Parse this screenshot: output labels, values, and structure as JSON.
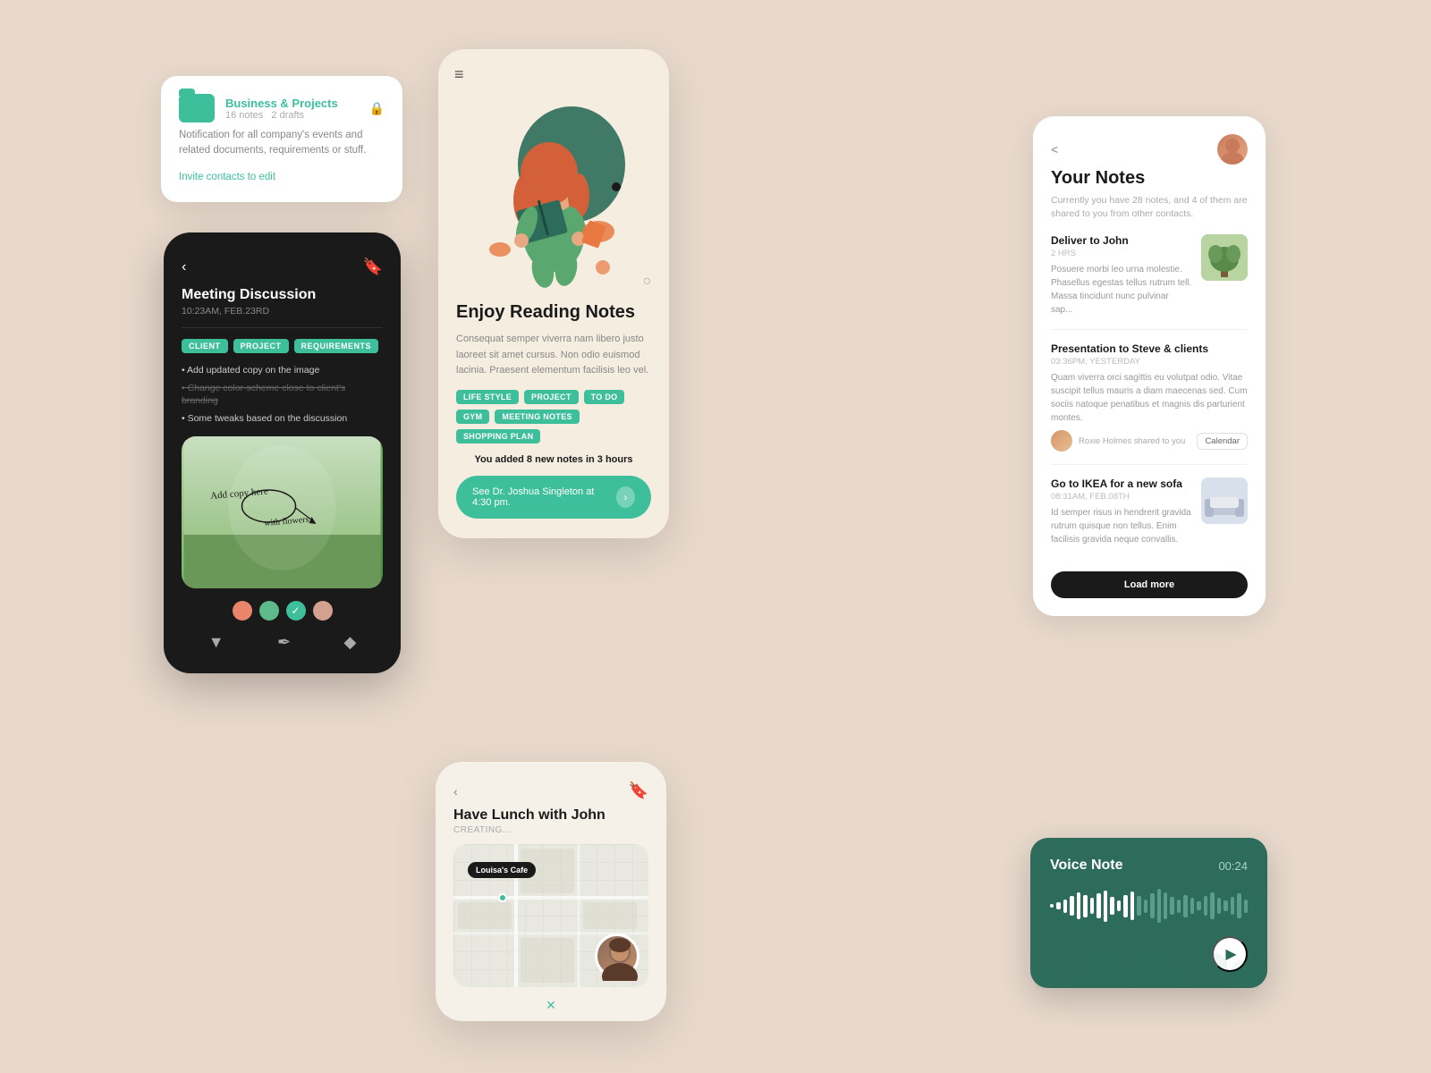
{
  "background": "#e8d9cc",
  "card_business": {
    "title": "Business & Projects",
    "notes_count": "16 notes",
    "drafts_count": "2 drafts",
    "description": "Notification for all company's events and related documents, requirements or stuff.",
    "invite_link": "Invite contacts to edit"
  },
  "card_meeting": {
    "title": "Meeting Discussion",
    "date": "10:23AM, FEB.23RD",
    "tags": [
      "CLIENT",
      "PROJECT",
      "REQUIREMENTS"
    ],
    "points": [
      {
        "text": "Add updated copy on the image",
        "strikethrough": false
      },
      {
        "text": "Change color-scheme close to client's branding",
        "strikethrough": true
      },
      {
        "text": "Some tweaks based on the discussion",
        "strikethrough": false
      }
    ],
    "img_text": "Add copy here",
    "img_subtext": "with flowers"
  },
  "card_reading": {
    "title": "Enjoy Reading Notes",
    "description": "Consequat semper viverra nam libero justo laoreet sit amet cursus. Non odio euismod lacinia. Praesent elementum facilisis leo vel.",
    "tags": [
      "LIFE STYLE",
      "PROJECT",
      "TO DO",
      "GYM",
      "MEETING NOTES",
      "SHOPPING PLAN"
    ],
    "notes_count": "You added 8 new notes in 3 hours",
    "reminder": "See Dr. Joshua Singleton at 4:30 pm."
  },
  "card_your_notes": {
    "back": "<",
    "title": "Your Notes",
    "subtitle": "Currently you have 28 notes, and 4 of them are shared to you from other contacts.",
    "notes": [
      {
        "title": "Deliver to John",
        "time": "2 HRS",
        "desc": "Posuere morbi leo urna molestie. Phasellus egestas tellus rutrum tell. Massa tincidunt nunc pulvinar sap...",
        "has_thumb": true,
        "thumb_type": "plant"
      },
      {
        "title": "Presentation to Steve & clients",
        "time": "03:36PM, YESTERDAY",
        "desc": "Quam viverra orci sagittis eu volutpat odio. Vitae suscipit tellus mauris a diam maecenas sed. Cum sociis natoque penatibus et magnis dis parturient montes.",
        "has_thumb": false,
        "shared_by": "Roxie Holmes shared to you",
        "calendar_btn": "Calendar"
      },
      {
        "title": "Go to IKEA for a new sofa",
        "time": "08:31AM, FEB.08TH",
        "desc": "Id semper risus in hendrerit gravida rutrum quisque non tellus. Enim facilisis gravida neque convallis.",
        "has_thumb": true,
        "thumb_type": "sofa"
      }
    ],
    "load_more": "Load more"
  },
  "card_lunch": {
    "title": "Have Lunch with John",
    "status": "CREATING...",
    "map_label": "Louisa's Cafe",
    "close": "×"
  },
  "card_voice": {
    "title": "Voice Note",
    "duration": "00:24",
    "wave_bars": [
      3,
      8,
      15,
      22,
      30,
      25,
      18,
      28,
      35,
      20,
      12,
      25,
      32,
      22,
      15,
      28,
      38,
      30,
      20,
      15,
      25,
      18,
      10,
      22,
      30,
      18,
      12,
      20,
      28,
      15
    ],
    "active_bars": [
      0,
      1,
      2,
      3,
      4,
      5,
      6,
      7,
      8,
      9,
      10,
      11,
      12
    ]
  }
}
